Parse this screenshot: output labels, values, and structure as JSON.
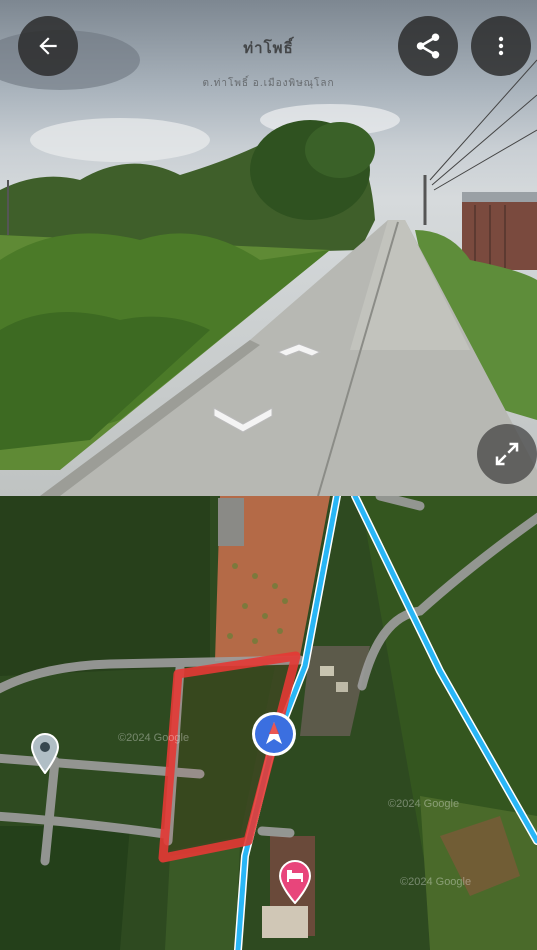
{
  "street_view": {
    "title": "ท่าโพธิ์",
    "subtitle": "ต.ท่าโพธิ์ อ.เมืองพิษณุโลก"
  },
  "toolbar": {
    "back_icon": "arrow-left-icon",
    "share_icon": "share-icon",
    "more_icon": "more-vertical-icon",
    "expand_icon": "expand-icon"
  },
  "map": {
    "watermarks": [
      "©2024 Google",
      "©2024 Google",
      "©2024 Google"
    ],
    "colors": {
      "boundary": "#e53935",
      "street_view_line": "#29b6f6",
      "road": "#9e9e9e",
      "pegman": "#3b6fe0",
      "hotel_pin": "#e8457b"
    }
  }
}
